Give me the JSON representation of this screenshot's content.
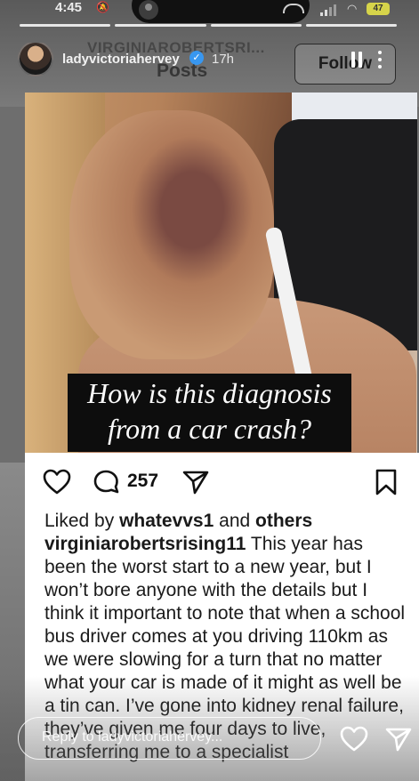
{
  "status_bar": {
    "time": "4:45",
    "battery": "47"
  },
  "story": {
    "progress_segments": 4,
    "username": "ladyvictoriahervey",
    "verified": true,
    "time_ago": "17h",
    "follow_label": "Follow",
    "reply_placeholder": "Reply to ladyvictoriahervey..."
  },
  "background_profile": {
    "handle": "VIRGINIAROBERTSRI...",
    "section": "Posts"
  },
  "post": {
    "image_caption_line1": "How is this diagnosis",
    "image_caption_line2": "from a car crash?",
    "comment_count": "257",
    "liked_by_prefix": "Liked by",
    "liked_by_user": "whatevvs1",
    "liked_by_and": "and",
    "liked_by_others": "others",
    "author": "virginiarobertsrising11",
    "caption": "This year has been the worst start to a new year, but I won’t bore anyone with the details but I think it important to note that when a school bus driver comes at you driving 110km as we were slowing for a turn that no matter what your car is made of it might as well be a tin can. I’ve gone into kidney renal failure, they’ve given me four days to live, transferring me to a specialist"
  },
  "colors": {
    "verified_badge": "#3897f0",
    "battery": "#d6d44a",
    "post_background": "#ffffff"
  }
}
